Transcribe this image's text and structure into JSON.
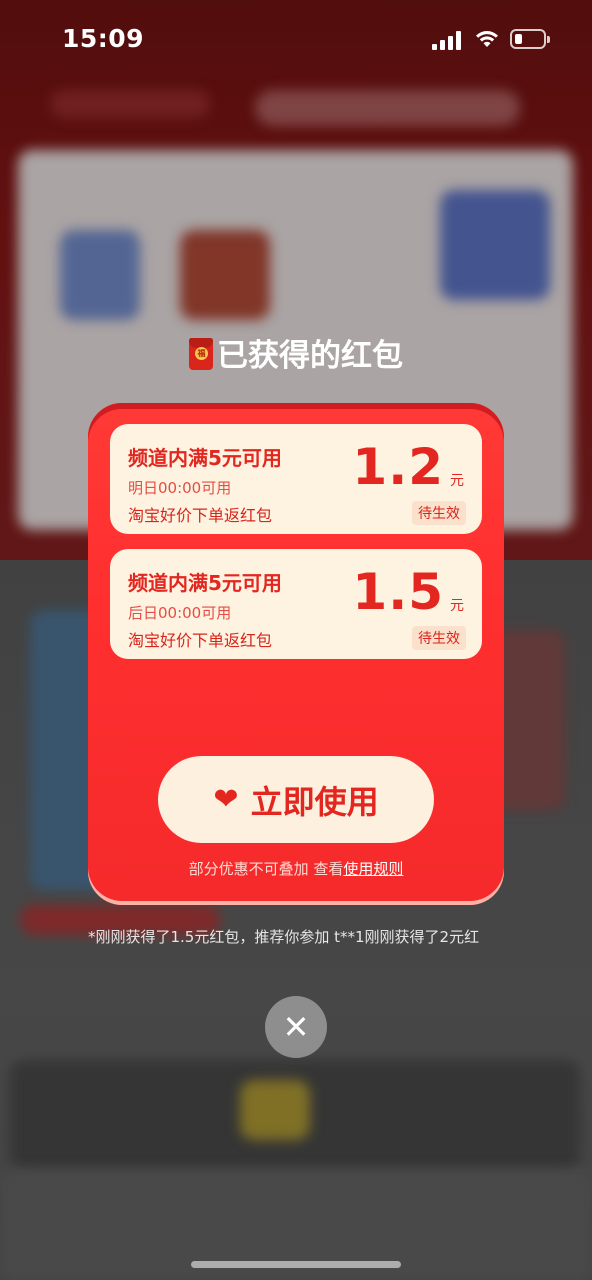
{
  "status_bar": {
    "time": "15:09"
  },
  "modal": {
    "title": "已获得的红包",
    "coupons": [
      {
        "condition": "频道内满5元可用",
        "validity": "明日00:00可用",
        "source": "淘宝好价下单返红包",
        "amount": "1.2",
        "unit": "元",
        "status": "待生效"
      },
      {
        "condition": "频道内满5元可用",
        "validity": "后日00:00可用",
        "source": "淘宝好价下单返红包",
        "amount": "1.5",
        "unit": "元",
        "status": "待生效"
      }
    ],
    "use_button": "立即使用",
    "note_prefix": "部分优惠不可叠加 查看",
    "rules_link": "使用规则"
  },
  "ticker": "*刚刚获得了1.5元红包，推荐你参加 t**1刚刚获得了2元红",
  "close_symbol": "✕",
  "colors": {
    "accent": "#ff2f2f",
    "coupon_bg": "#fdf3e0",
    "text_red": "#e3261f"
  }
}
